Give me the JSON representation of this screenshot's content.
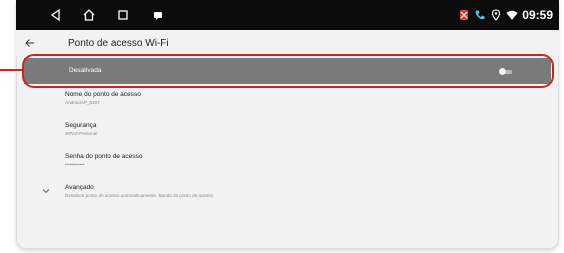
{
  "status_bar": {
    "time": "09:59",
    "icons": [
      "back-triangle-icon",
      "home-icon",
      "recents-square-icon",
      "notification-icon",
      "no-sim-icon",
      "call-icon",
      "location-icon",
      "wifi-icon"
    ]
  },
  "app_bar": {
    "title": "Ponto de acesso Wi-Fi",
    "back_icon": "arrow-back-icon"
  },
  "hotspot_toggle": {
    "label": "Desativada",
    "state": "off"
  },
  "settings": [
    {
      "title": "Nome do ponto de acesso",
      "summary": "AndroidAP_8207"
    },
    {
      "title": "Segurança",
      "summary": "WPA2-Personal"
    },
    {
      "title": "Senha do ponto de acesso",
      "summary": "••••••••••••"
    },
    {
      "title": "Avançado",
      "summary": "Desativar ponto de acesso automaticamente, Banda do ponto de acesso"
    }
  ],
  "colors": {
    "highlight": "#c62828",
    "toggle_row_bg": "#7a7a7a",
    "statusbar_bg": "#0c0c0c"
  }
}
